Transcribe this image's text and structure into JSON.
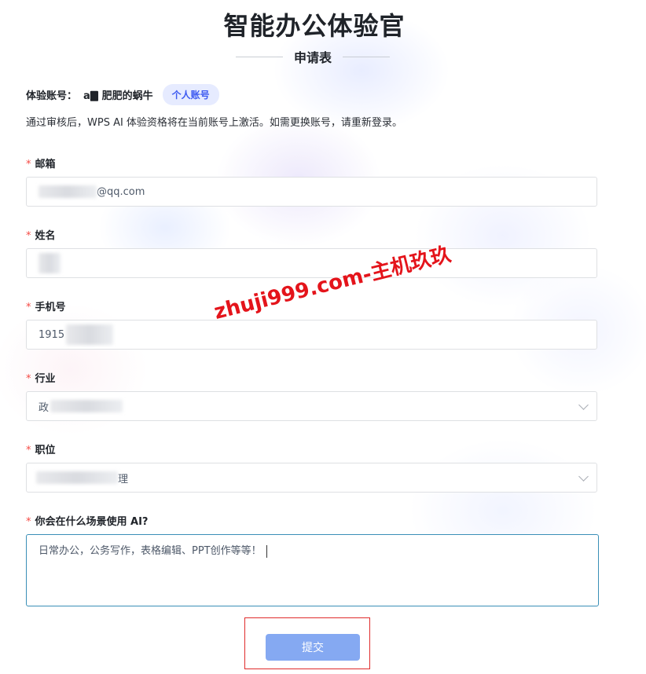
{
  "page": {
    "title": "智能办公体验官",
    "subtitle": "申请表"
  },
  "account": {
    "label": "体验账号：",
    "name": "a🀫 肥肥的蜗牛",
    "tag": "个人账号"
  },
  "notice": "通过审核后，WPS AI 体验资格将在当前账号上激活。如需更换账号，请重新登录。",
  "form": {
    "required_mark": "*",
    "email": {
      "label": "邮箱",
      "value_suffix": "@qq.com"
    },
    "name": {
      "label": "姓名"
    },
    "phone": {
      "label": "手机号",
      "value_prefix": "1915"
    },
    "industry": {
      "label": "行业",
      "value_prefix": "政"
    },
    "position": {
      "label": "职位",
      "value_suffix": "理"
    },
    "scenario": {
      "label": "你会在什么场景使用 AI?",
      "value": "日常办公，公务写作，表格编辑、PPT创作等等！"
    }
  },
  "submit_label": "提交",
  "watermark": "zhuji999.com-主机玖玖",
  "colors": {
    "required": "#f54a45",
    "tag_bg": "#e6ebff",
    "tag_text": "#3d5af1",
    "submit_bg": "#85a9f2",
    "focus_border": "#3a8fb7",
    "highlight_box": "#e02b2b",
    "watermark": "#e4141b"
  }
}
